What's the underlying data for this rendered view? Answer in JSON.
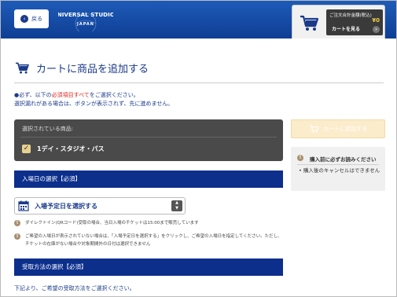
{
  "header": {
    "back_label": "戻る",
    "logo_line1": "UNIVERSAL STUDIOS",
    "logo_line2": "JAPAN",
    "cart_total_label": "ご注文合計金額(税込)",
    "cart_total_value": "¥0",
    "view_cart_label": "カートを見る"
  },
  "page": {
    "title": "カートに商品を追加する",
    "notice_line1_prefix": "●必ず、以下の",
    "notice_line1_red": "必須項目すべて",
    "notice_line1_suffix": "をご選択ください。",
    "notice_line2": "選択漏れがある場合は、ボタンが表示されず、先に進めません。"
  },
  "selected": {
    "header": "選択されている商品:",
    "product": "1デイ・スタジオ・パス"
  },
  "sidebar": {
    "add_to_cart_label": "カートに追加する",
    "read_title": "購入前に必ずお読みください",
    "read_item": "• 購入後のキャンセルはできません"
  },
  "entry_date": {
    "section_title": "入場日の選択【必須】",
    "select_label": "入場予定日を選択する",
    "info1": "ダイレクトイン(QRコード)受取の場合、当日入場のチケットは15:00まで販売しています",
    "info2": "ご希望の入場日が表示されていない場合は、「入場予定日を選択する」をクリックし、ご希望の入場日を指定してください。ただし、チケットの在庫がない場合や対象期間外の日付は選択できません"
  },
  "receive": {
    "section_title": "受取方法の選択【必須】",
    "note": "下記より、ご希望の受取方法をご選択ください。"
  },
  "colors": {
    "header_blue": "#0f3e94",
    "section_blue": "#0c2f8c",
    "accent_red": "#d9261c",
    "disabled_gold": "#fbeccc"
  }
}
